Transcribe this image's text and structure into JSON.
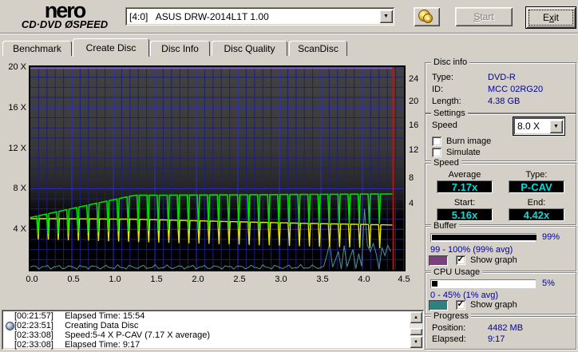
{
  "toolbar": {
    "logo_line1": "nero",
    "logo_line2": "CD·DVD ØSPEED",
    "drive": "[4:0]   ASUS DRW-2014L1T 1.00",
    "start_label": "Start",
    "exit_label": "Exit"
  },
  "tabs": [
    {
      "label": "Benchmark",
      "active": false
    },
    {
      "label": "Create Disc",
      "active": true
    },
    {
      "label": "Disc Info",
      "active": false
    },
    {
      "label": "Disc Quality",
      "active": false
    },
    {
      "label": "ScanDisc",
      "active": false
    }
  ],
  "disc_info": {
    "title": "Disc info",
    "rows": [
      {
        "label": "Type:",
        "value": "DVD-R"
      },
      {
        "label": "ID:",
        "value": "MCC 02RG20"
      },
      {
        "label": "Length:",
        "value": "4.38 GB"
      }
    ]
  },
  "settings": {
    "title": "Settings",
    "speed_label": "Speed",
    "speed_value": "8.0 X",
    "checkboxes": [
      {
        "label": "Burn image",
        "checked": false
      },
      {
        "label": "Simulate",
        "checked": false
      }
    ]
  },
  "speed": {
    "title": "Speed",
    "average_label": "Average",
    "average": "7.17x",
    "type_label": "Type:",
    "type": "P-CAV",
    "start_label": "Start:",
    "start": "5.16x",
    "end_label": "End:",
    "end": "4.42x"
  },
  "buffer": {
    "title": "Buffer",
    "bar_pct": 99,
    "pct_label": "99%",
    "range": "99 - 100% (99% avg)",
    "graph_color": "#7b3f7b",
    "show_graph_label": "Show graph",
    "show_graph_checked": true
  },
  "cpu": {
    "title": "CPU Usage",
    "bar_pct": 5,
    "pct_label": "5%",
    "range": "0 - 45% (1% avg)",
    "graph_color": "#2f8080",
    "show_graph_label": "Show graph",
    "show_graph_checked": true
  },
  "progress": {
    "title": "Progress",
    "position_label": "Position:",
    "position": "4482 MB",
    "elapsed_label": "Elapsed:",
    "elapsed": "9:17"
  },
  "log": {
    "entries": [
      {
        "time": "[00:21:57]",
        "text": "Elapsed Time: 15:54",
        "icon": false
      },
      {
        "time": "[02:23:51]",
        "text": "Creating Data Disc",
        "icon": true
      },
      {
        "time": "[02:33:08]",
        "text": "Speed:5-4 X P-CAV (7.17 X average)",
        "icon": false
      },
      {
        "time": "[02:33:08]",
        "text": "Elapsed Time: 9:17",
        "icon": false
      }
    ]
  },
  "chart_data": {
    "type": "line",
    "x_unit": "GB",
    "xlim": [
      0,
      4.5
    ],
    "ylim_speed": [
      0,
      20
    ],
    "pct_lim": [
      0,
      100
    ],
    "xmax_data": 4.36,
    "grid_minor": "#1f1f78",
    "grid_major": "#2a2ad2",
    "x_ticks": [
      "0.0",
      "0.5",
      "1.0",
      "1.5",
      "2.0",
      "2.5",
      "3.0",
      "3.5",
      "4.0",
      "4.5"
    ],
    "left_axis": {
      "labels": [
        "20 X",
        "16 X",
        "12 X",
        "8 X",
        "4 X"
      ]
    },
    "right_axis": {
      "labels": [
        "24",
        "20",
        "16",
        "12",
        "8",
        "4"
      ]
    },
    "series": [
      {
        "name": "write-speed",
        "color": "#00dc00",
        "unit": "X",
        "envelope": [
          [
            0,
            5.16
          ],
          [
            1.25,
            7.35
          ],
          [
            2.5,
            7.4
          ],
          [
            4.36,
            7.48
          ]
        ],
        "dips": {
          "first": 0.09,
          "last": 4.32,
          "spacing": 0.121,
          "min_start": 3.5,
          "min_end": 4.6
        }
      },
      {
        "name": "transfer-rate",
        "color": "#e6e600",
        "unit": "X",
        "envelope": [
          [
            0,
            5.05
          ],
          [
            1.2,
            5.0
          ],
          [
            2.2,
            4.8
          ],
          [
            3.2,
            4.6
          ],
          [
            4.36,
            4.42
          ]
        ],
        "dips": {
          "first": 0.095,
          "last": 4.325,
          "spacing": 0.121,
          "min_start": 3.0,
          "min_end": 2.1
        }
      }
    ],
    "buffer_series": {
      "name": "buffer-level",
      "color": "#a85aa8",
      "unit": "%",
      "value": 99.4
    },
    "cpu_series": {
      "name": "cpu-usage",
      "color": "#4d9494",
      "unit": "%",
      "baseline": 1.3,
      "spikes": [
        [
          3.58,
          7
        ],
        [
          3.62,
          13
        ],
        [
          3.66,
          5
        ],
        [
          3.72,
          9
        ],
        [
          3.78,
          12
        ],
        [
          3.84,
          6
        ],
        [
          3.9,
          10
        ],
        [
          3.96,
          8
        ],
        [
          4.02,
          30
        ],
        [
          4.06,
          12
        ],
        [
          4.1,
          9
        ],
        [
          4.14,
          13
        ],
        [
          4.18,
          8
        ],
        [
          4.22,
          11
        ],
        [
          4.26,
          7
        ],
        [
          4.3,
          12
        ],
        [
          4.34,
          9
        ]
      ]
    },
    "position_marker": {
      "x": 4.37,
      "color": "#cc1111"
    }
  }
}
